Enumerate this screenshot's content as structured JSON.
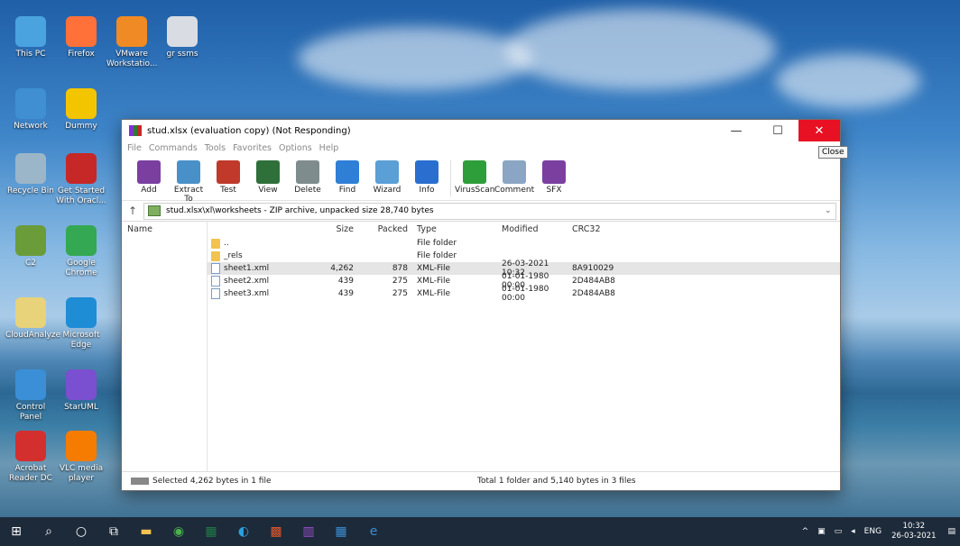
{
  "desktop": {
    "icons": [
      {
        "label": "This PC",
        "icon": "computer-icon",
        "color": "#4aa3df"
      },
      {
        "label": "Firefox",
        "icon": "firefox-icon",
        "color": "#ff7139"
      },
      {
        "label": "VMware Workstatio...",
        "icon": "vmware-icon",
        "color": "#f08a24"
      },
      {
        "label": "gr ssms",
        "icon": "file-icon",
        "color": "#d9dde3"
      },
      {
        "label": "Network",
        "icon": "network-icon",
        "color": "#3f8fd2"
      },
      {
        "label": "Dummy",
        "icon": "teapot-icon",
        "color": "#f2c500"
      },
      {
        "label": "Recycle Bin",
        "icon": "recycle-bin-icon",
        "color": "#9cb6c9"
      },
      {
        "label": "Get Started With Oracl...",
        "icon": "database-icon",
        "color": "#c62828"
      },
      {
        "label": "C2",
        "icon": "c-icon",
        "color": "#6b9c3a"
      },
      {
        "label": "Google Chrome",
        "icon": "chrome-icon",
        "color": "#34a853"
      },
      {
        "label": "CloudAnalyze",
        "icon": "document-icon",
        "color": "#e8d27a"
      },
      {
        "label": "Microsoft Edge",
        "icon": "edge-icon",
        "color": "#1f8cd6"
      },
      {
        "label": "Control Panel",
        "icon": "control-panel-icon",
        "color": "#3a8fd6"
      },
      {
        "label": "StarUML",
        "icon": "staruml-icon",
        "color": "#7a4fd0"
      },
      {
        "label": "Acrobat Reader DC",
        "icon": "acrobat-icon",
        "color": "#d32f2f"
      },
      {
        "label": "VLC media player",
        "icon": "vlc-icon",
        "color": "#f57c00"
      }
    ]
  },
  "window": {
    "title": "stud.xlsx (evaluation copy) (Not Responding)",
    "close_tooltip": "Close",
    "menu": [
      "File",
      "Commands",
      "Tools",
      "Favorites",
      "Options",
      "Help"
    ],
    "toolbar": [
      {
        "label": "Add",
        "icon": "add-archive-icon",
        "color": "#7b3fa0"
      },
      {
        "label": "Extract To",
        "icon": "extract-folder-icon",
        "color": "#4a90c8"
      },
      {
        "label": "Test",
        "icon": "test-icon",
        "color": "#c0392b"
      },
      {
        "label": "View",
        "icon": "view-book-icon",
        "color": "#2f6f3a"
      },
      {
        "label": "Delete",
        "icon": "delete-bin-icon",
        "color": "#7f8c8d"
      },
      {
        "label": "Find",
        "icon": "find-magnifier-icon",
        "color": "#2f7fd6"
      },
      {
        "label": "Wizard",
        "icon": "wizard-wand-icon",
        "color": "#5a9fd6"
      },
      {
        "label": "Info",
        "icon": "info-icon",
        "color": "#2a6fcf"
      },
      {
        "label": "VirusScan",
        "icon": "virus-scan-icon",
        "color": "#2e9e3a"
      },
      {
        "label": "Comment",
        "icon": "comment-icon",
        "color": "#8aa6c4"
      },
      {
        "label": "SFX",
        "icon": "sfx-icon",
        "color": "#7b3fa0"
      }
    ],
    "path": "stud.xlsx\\xl\\worksheets - ZIP archive, unpacked size 28,740 bytes",
    "columns": {
      "name": "Name",
      "size": "Size",
      "packed": "Packed",
      "type": "Type",
      "modified": "Modified",
      "crc": "CRC32"
    },
    "rows": [
      {
        "name": "..",
        "size": "",
        "packed": "",
        "type": "File folder",
        "modified": "",
        "crc": "",
        "kind": "folder",
        "selected": false
      },
      {
        "name": "_rels",
        "size": "",
        "packed": "",
        "type": "File folder",
        "modified": "",
        "crc": "",
        "kind": "folder",
        "selected": false
      },
      {
        "name": "sheet1.xml",
        "size": "4,262",
        "packed": "878",
        "type": "XML-File",
        "modified": "26-03-2021 10:32",
        "crc": "8A910029",
        "kind": "xml",
        "selected": true
      },
      {
        "name": "sheet2.xml",
        "size": "439",
        "packed": "275",
        "type": "XML-File",
        "modified": "01-01-1980 00:00",
        "crc": "2D484AB8",
        "kind": "xml",
        "selected": false
      },
      {
        "name": "sheet3.xml",
        "size": "439",
        "packed": "275",
        "type": "XML-File",
        "modified": "01-01-1980 00:00",
        "crc": "2D484AB8",
        "kind": "xml",
        "selected": false
      }
    ],
    "status_left": "Selected 4,262 bytes in 1 file",
    "status_right": "Total 1 folder and 5,140 bytes in 3 files"
  },
  "taskbar": {
    "apps": [
      "windows-start-icon",
      "search-icon",
      "cortana-icon",
      "task-view-icon",
      "file-explorer-icon",
      "chrome-icon",
      "excel-icon",
      "edge-icon",
      "office-icon",
      "winrar-icon",
      "mail-icon",
      "ie-icon"
    ],
    "language": "ENG",
    "time": "10:32",
    "date": "26-03-2021"
  }
}
